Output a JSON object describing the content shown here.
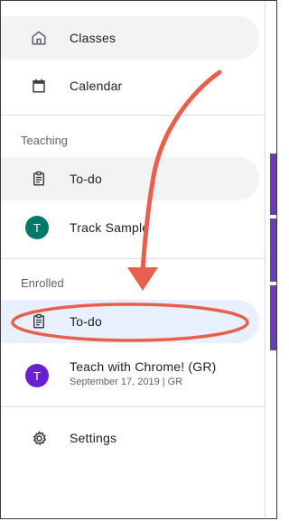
{
  "nav": {
    "classes_label": "Classes",
    "calendar_label": "Calendar"
  },
  "teaching": {
    "section_label": "Teaching",
    "todo_label": "To-do",
    "course": {
      "avatar_letter": "T",
      "name": "Track Sample",
      "avatar_color": "#00796b"
    }
  },
  "enrolled": {
    "section_label": "Enrolled",
    "todo_label": "To-do",
    "course": {
      "avatar_letter": "T",
      "name": "Teach with Chrome! (GR)",
      "subtitle": "September 17, 2019 | GR",
      "avatar_color": "#6a1fd0"
    }
  },
  "settings_label": "Settings",
  "colors": {
    "highlight": "#f1f3f4",
    "selected": "#e8f0fe",
    "annotation": "#e8604c",
    "accent_purple": "#6b3fb4"
  }
}
